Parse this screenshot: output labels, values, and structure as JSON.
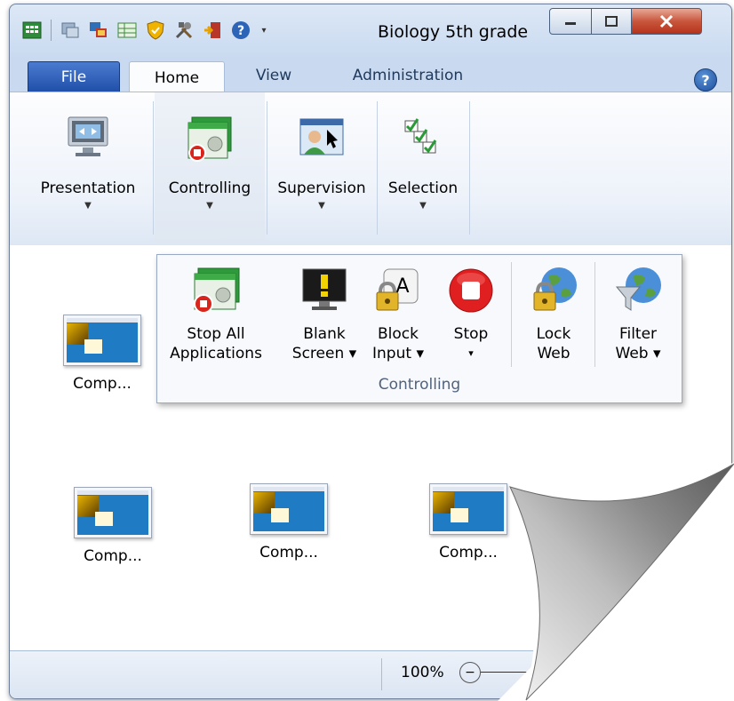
{
  "window": {
    "title": "Biology 5th grade"
  },
  "quick_access": [
    {
      "icon": "grid-icon"
    },
    {
      "icon": "remote-icon"
    },
    {
      "icon": "network-icon"
    },
    {
      "icon": "table-icon"
    },
    {
      "icon": "shield-icon"
    },
    {
      "icon": "tools-icon"
    },
    {
      "icon": "exit-icon"
    },
    {
      "icon": "help-icon"
    }
  ],
  "tabs": {
    "file": "File",
    "home": "Home",
    "view": "View",
    "administration": "Administration"
  },
  "ribbon": {
    "presentation": "Presentation",
    "controlling": "Controlling",
    "supervision": "Supervision",
    "selection": "Selection"
  },
  "controlling_menu": {
    "group_label": "Controlling",
    "stop_all": [
      "Stop All",
      "Applications"
    ],
    "blank_screen": [
      "Blank",
      "Screen ▾"
    ],
    "block_input": [
      "Block",
      "Input ▾"
    ],
    "stop": [
      "Stop",
      "▾"
    ],
    "lock_web": [
      "Lock",
      "Web"
    ],
    "filter_web": [
      "Filter",
      "Web ▾"
    ]
  },
  "computers": [
    {
      "label": "Comp..."
    },
    {
      "label": "Comp..."
    },
    {
      "label": "Comp..."
    },
    {
      "label": "Comp..."
    }
  ],
  "status": {
    "zoom": "100%"
  },
  "colors": {
    "file_tab": "#2a5cb8",
    "close_button": "#c8563c",
    "stop_red": "#e02020"
  }
}
